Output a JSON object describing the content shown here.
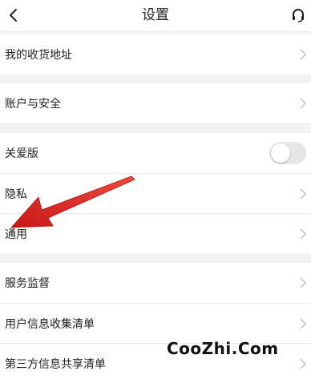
{
  "header": {
    "title": "设置",
    "back_icon": "chevron-left-icon",
    "right_icon": "headset-icon"
  },
  "groups": [
    {
      "items": [
        {
          "label": "我的收货地址",
          "control": "chevron"
        }
      ]
    },
    {
      "items": [
        {
          "label": "账户与安全",
          "control": "chevron"
        }
      ]
    },
    {
      "items": [
        {
          "label": "关爱版",
          "control": "toggle",
          "toggle_on": false
        },
        {
          "label": "隐私",
          "control": "chevron"
        },
        {
          "label": "通用",
          "control": "chevron"
        }
      ]
    },
    {
      "items": [
        {
          "label": "服务监督",
          "control": "chevron"
        },
        {
          "label": "用户信息收集清单",
          "control": "chevron"
        },
        {
          "label": "第三方信息共享清单",
          "control": "chevron"
        }
      ]
    }
  ],
  "annotation": {
    "type": "red-arrow",
    "points_to": "通用",
    "color": "#e02020"
  },
  "watermark": "CooZhi.Com",
  "colors": {
    "background": "#f2f2f2",
    "row": "#ffffff",
    "divider": "#ececec",
    "chevron": "#c8c8c8",
    "toggle_off": "#e6e6e6"
  }
}
